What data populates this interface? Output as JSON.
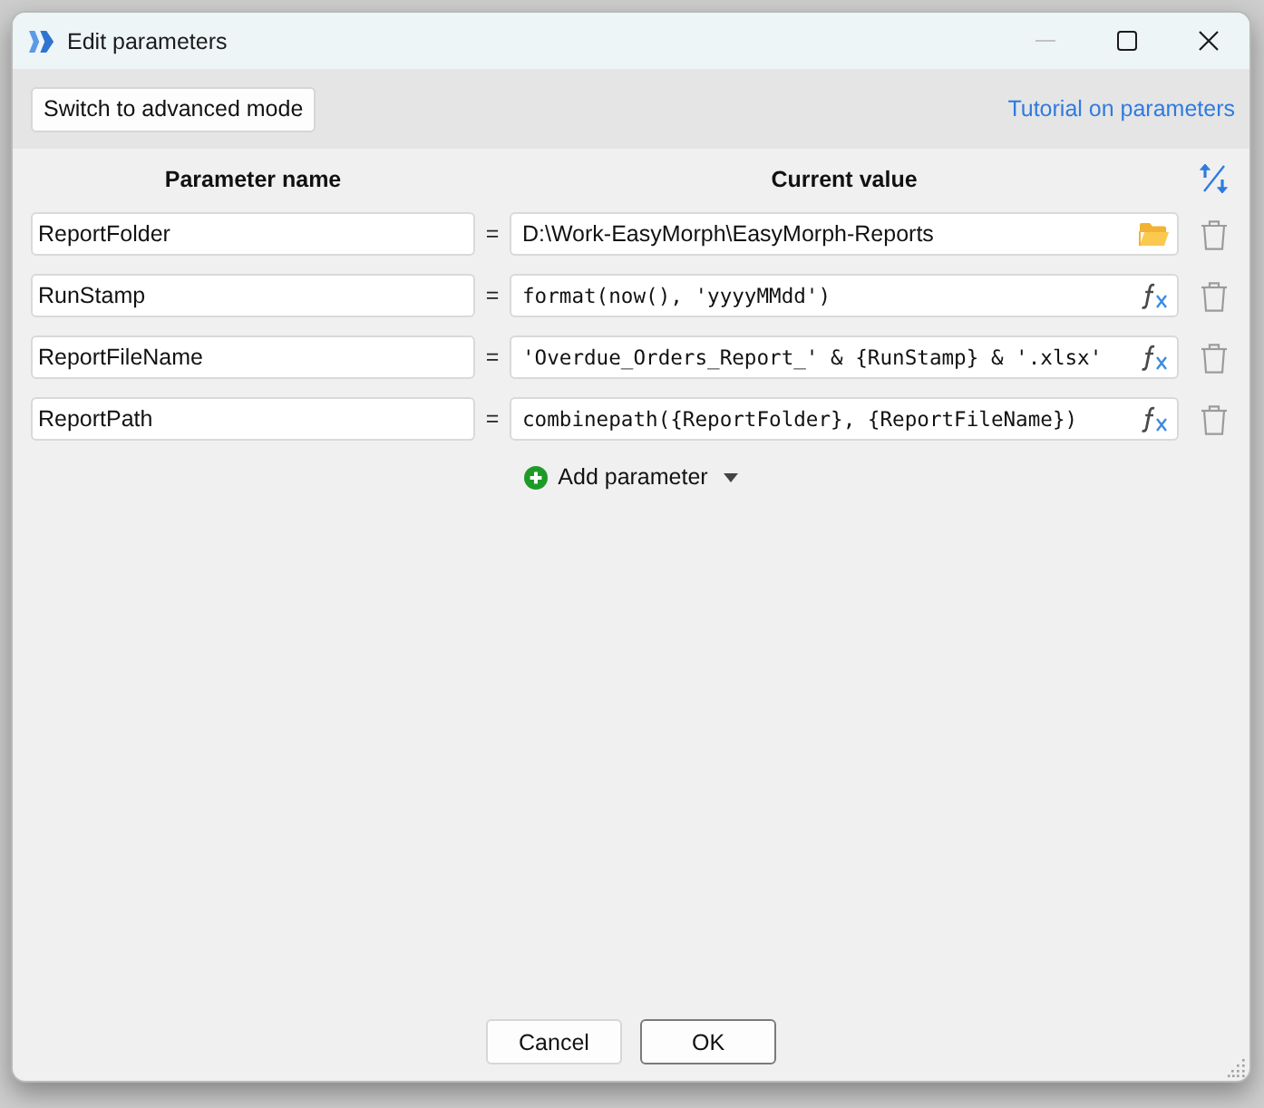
{
  "window": {
    "title": "Edit parameters",
    "controls": [
      {
        "kind": "minimize",
        "disabled": true
      },
      {
        "kind": "maximize",
        "disabled": false
      },
      {
        "kind": "close",
        "disabled": false
      }
    ]
  },
  "toolbar": {
    "mode_button": "Switch to advanced mode",
    "tutorial_link": "Tutorial on parameters"
  },
  "columns": {
    "name": "Parameter name",
    "value": "Current value"
  },
  "parameters": [
    {
      "name": "ReportFolder",
      "operator": "=",
      "value": "D:\\Work-EasyMorph\\EasyMorph-Reports",
      "kind": "folder"
    },
    {
      "name": "RunStamp",
      "operator": "=",
      "value": "format(now(), 'yyyyMMdd')",
      "kind": "expression"
    },
    {
      "name": "ReportFileName",
      "operator": "=",
      "value": "'Overdue_Orders_Report_' & {RunStamp} & '.xlsx'",
      "kind": "expression"
    },
    {
      "name": "ReportPath",
      "operator": "=",
      "value": "combinepath({ReportFolder}, {ReportFileName})",
      "kind": "expression"
    }
  ],
  "add_button": {
    "label": "Add parameter"
  },
  "buttons": [
    {
      "label": "Cancel",
      "default": false
    },
    {
      "label": "OK",
      "default": true
    }
  ]
}
